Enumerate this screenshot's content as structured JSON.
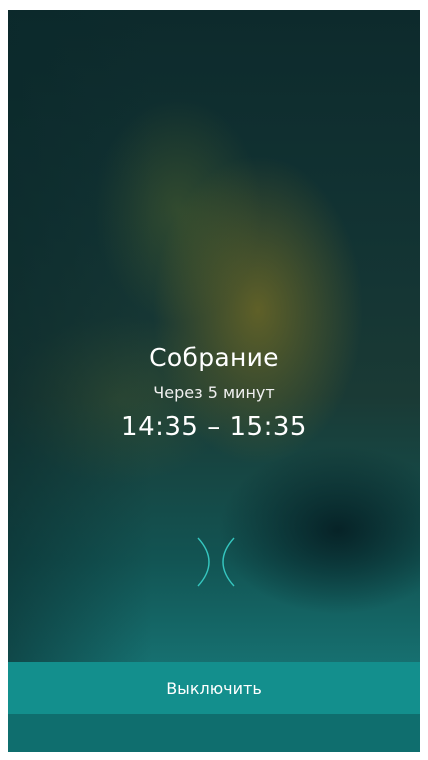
{
  "alarm": {
    "title": "Собрание",
    "subtitle": "Через 5 минут",
    "time_range": "14:35 – 15:35"
  },
  "actions": {
    "dismiss_label": "Выключить"
  },
  "icons": {
    "dismiss_mark": "close-chevrons-icon"
  },
  "colors": {
    "accent": "#138f8d",
    "icon_stroke": "#35c6bf",
    "text": "#ffffff"
  }
}
